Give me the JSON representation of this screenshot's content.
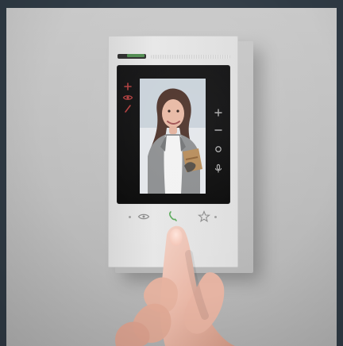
{
  "scene": {
    "description": "",
    "colors": {
      "background": "#2f3a44",
      "wall": "#c0c0c0",
      "device_frame": "#e1e1e1",
      "bezel": "#0c0c0c",
      "accent_green": "#5aa95a",
      "accent_red": "#b03a3a"
    }
  },
  "icons": {
    "left": [
      "plus-icon",
      "eye-icon",
      "slash-icon"
    ],
    "right": [
      "plus-icon",
      "minus-icon",
      "circle-icon",
      "microphone-icon"
    ],
    "bottom": [
      "eye-icon",
      "phone-icon",
      "star-icon"
    ]
  }
}
